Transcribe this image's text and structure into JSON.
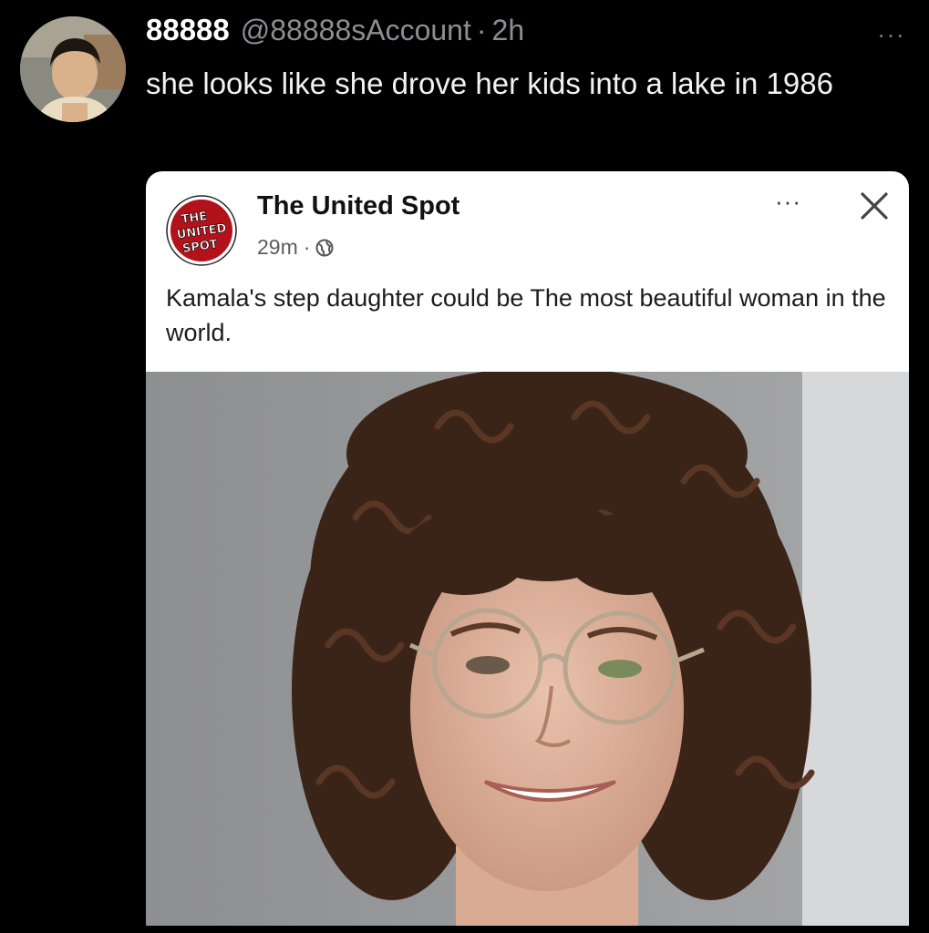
{
  "tweet": {
    "display_name": "88888",
    "handle": "@88888sAccount",
    "separator": "·",
    "time": "2h",
    "more_label": "···",
    "text": "she looks like she drove her kids into a lake in 1986",
    "avatar_icon": "person-photo"
  },
  "card": {
    "page_name": "The United Spot",
    "time": "29m",
    "separator": "·",
    "more_label": "···",
    "logo": {
      "line1": "THE",
      "line2": "UNITED",
      "line3": "SPOT",
      "color": "#b3121b"
    },
    "text": "Kamala's step daughter could be The most beautiful woman in the world.",
    "photo_icon": "portrait-photo",
    "close_icon": "close-x",
    "globe_icon": "globe"
  },
  "colors": {
    "background": "#000000",
    "card_background": "#ffffff",
    "muted_text": "#8b8f93"
  }
}
